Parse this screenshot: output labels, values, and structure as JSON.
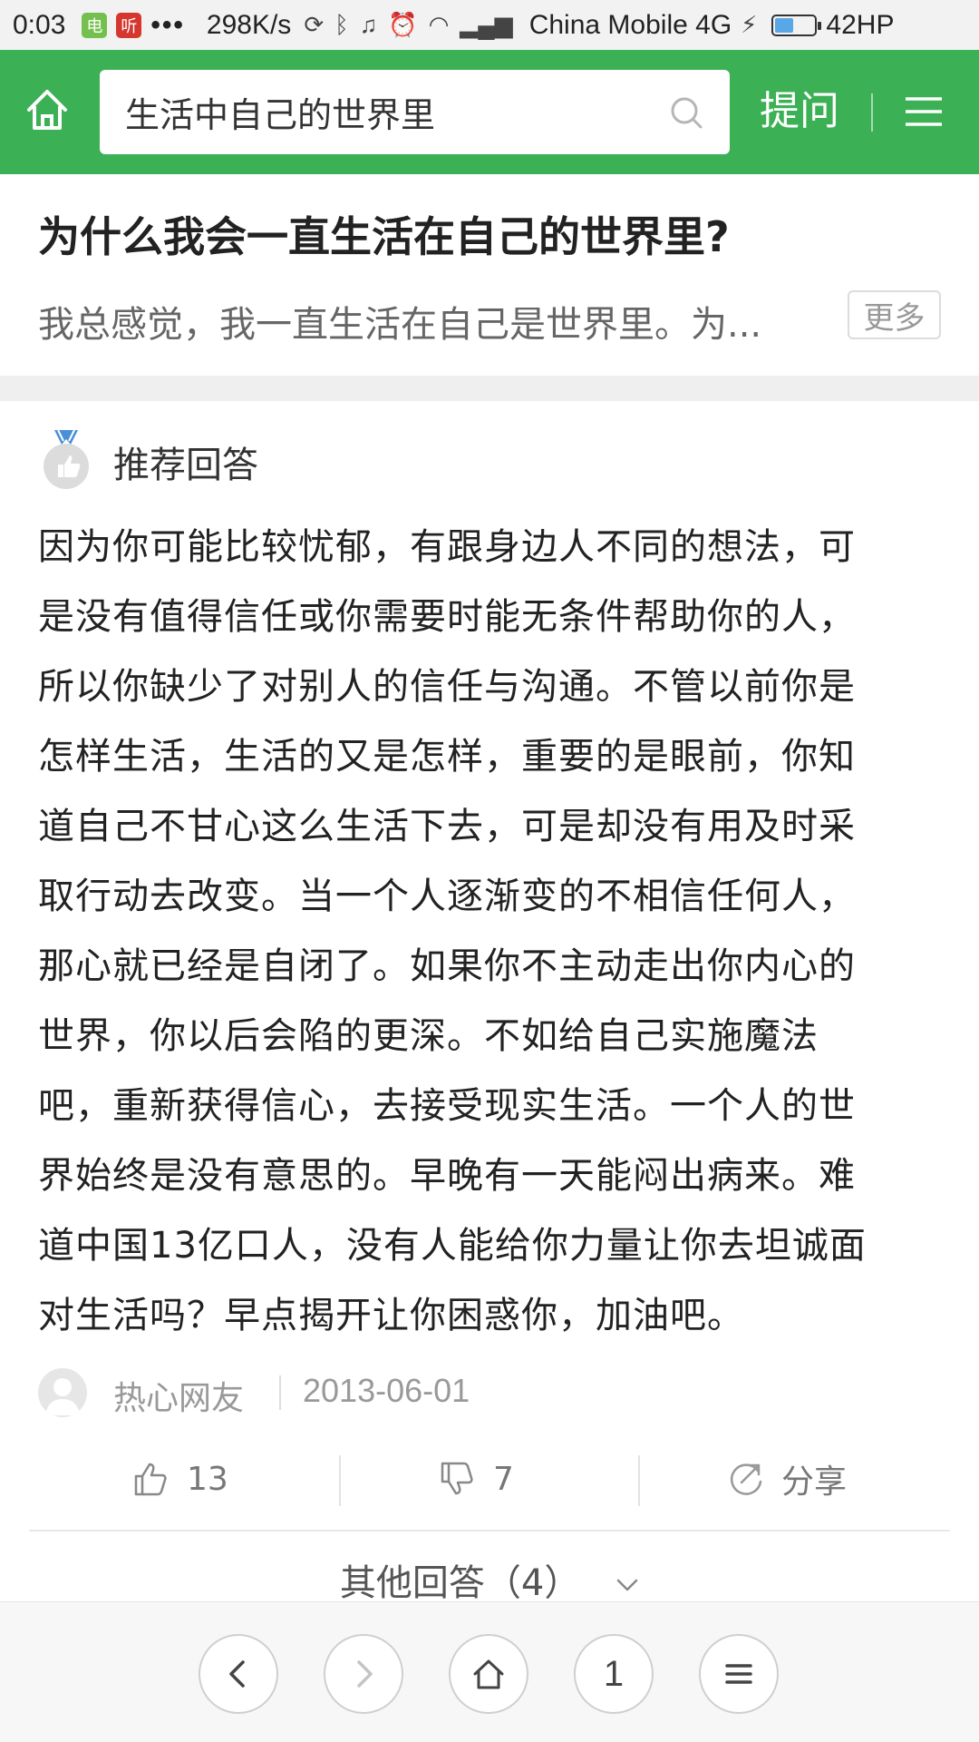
{
  "status_bar": {
    "time": "0:03",
    "app_icon_1": "电",
    "app_icon_2": "听",
    "more_dots": "•••",
    "speed": "298K/s",
    "carrier": "China Mobile 4G",
    "battery_text": "42HP",
    "battery_level": 0.42,
    "icons": [
      "sync-icon",
      "bluetooth-icon",
      "mute-icon",
      "alarm-icon",
      "wifi-icon",
      "signal-icon",
      "charging-icon"
    ]
  },
  "header": {
    "search_query": "生活中自己的世界里",
    "ask_label": "提问",
    "bg_color": "#3cb054"
  },
  "question": {
    "title": "为什么我会一直生活在自己的世界里?",
    "summary": "我总感觉，我一直生活在自己是世界里。为...",
    "more_label": "更多"
  },
  "answer": {
    "section_label": "推荐回答",
    "lines": [
      "因为你可能比较忧郁，有跟身边人不同的想法，可",
      "是没有值得信任或你需要时能无条件帮助你的人，",
      "所以你缺少了对别人的信任与沟通。不管以前你是",
      "怎样生活，生活的又是怎样，重要的是眼前，你知",
      "道自己不甘心这么生活下去，可是却没有用及时采",
      "取行动去改变。当一个人逐渐变的不相信任何人，",
      "那心就已经是自闭了。如果你不主动走出你内心的",
      "世界，你以后会陷的更深。不如给自己实施魔法",
      "吧，重新获得信心，去接受现实生活。一个人的世",
      "界始终是没有意思的。早晚有一天能闷出病来。难",
      "道中国13亿口人，没有人能给你力量让你去坦诚面",
      "对生活吗？早点揭开让你困惑你，加油吧。"
    ],
    "author": "热心网友",
    "date": "2013-06-01",
    "likes": "13",
    "dislikes": "7",
    "share_label": "分享"
  },
  "other_answers_label": "其他回答（4）",
  "bottom_nav": {
    "tabs_count": "1"
  }
}
